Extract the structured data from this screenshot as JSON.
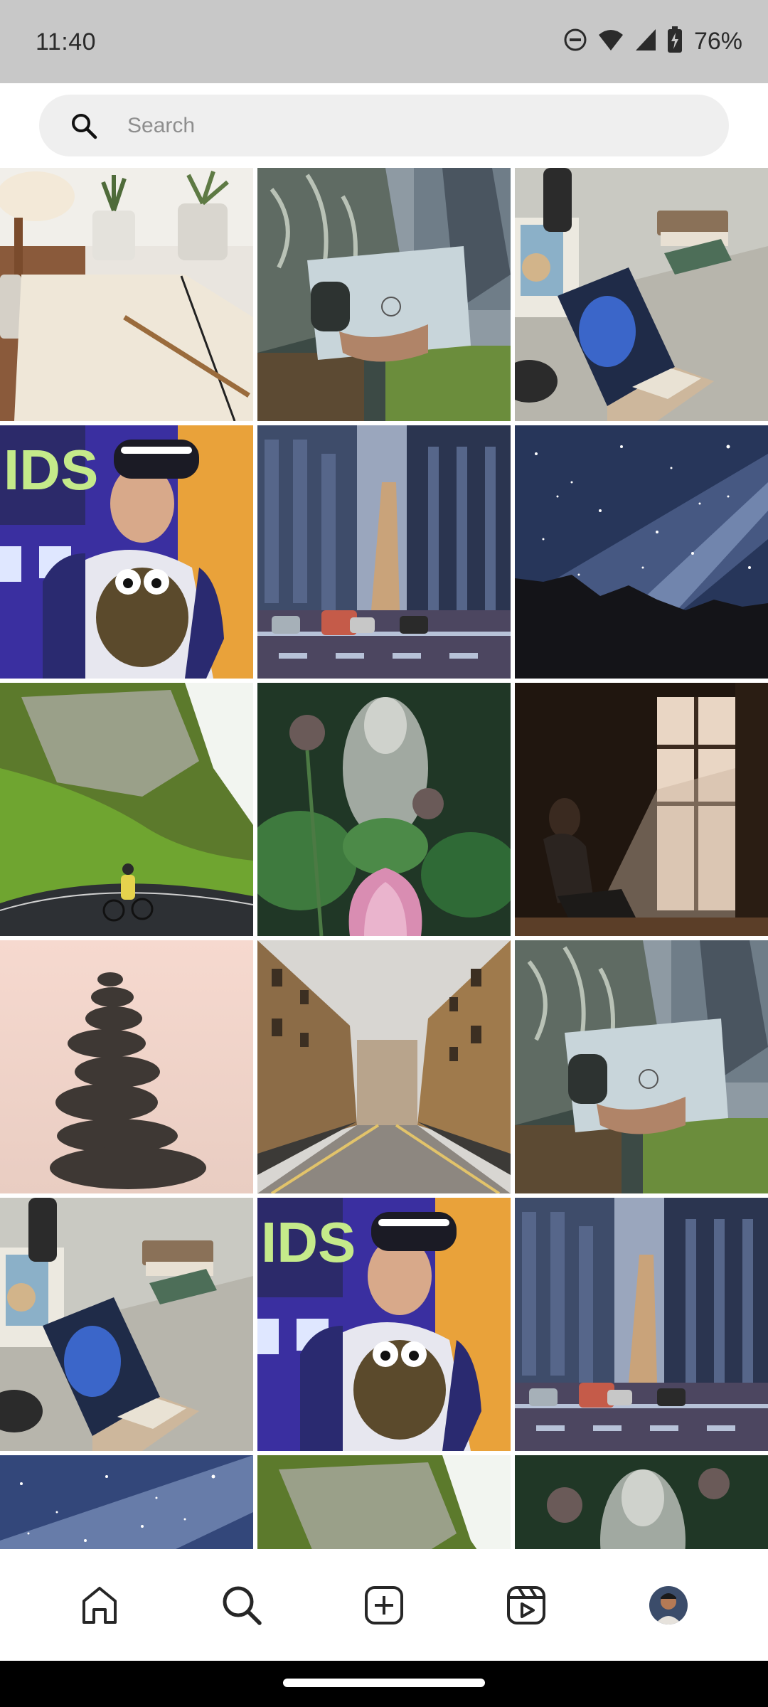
{
  "status_bar": {
    "time": "11:40",
    "battery_percent": "76%",
    "icons": [
      "do-not-disturb-icon",
      "wifi-icon",
      "cellular-signal-icon",
      "battery-charging-icon"
    ]
  },
  "search": {
    "placeholder": "Search",
    "icon": "search-icon"
  },
  "grid": {
    "columns": 3,
    "tiles": [
      {
        "subject": "notebook-and-pencil-on-desk-with-plants"
      },
      {
        "subject": "person-holding-dell-laptop"
      },
      {
        "subject": "laptop-on-desk-with-lamp"
      },
      {
        "subject": "person-wearing-vr-headset"
      },
      {
        "subject": "city-street-with-skyscrapers"
      },
      {
        "subject": "milky-way-night-sky-over-mountains"
      },
      {
        "subject": "cyclist-on-road-by-green-cliffs"
      },
      {
        "subject": "buddha-statue-with-lotus-flower"
      },
      {
        "subject": "woman-sitting-by-sunlit-window"
      },
      {
        "subject": "stacked-stones-cairn"
      },
      {
        "subject": "cobblestone-street-between-buildings"
      },
      {
        "subject": "person-holding-dell-laptop"
      },
      {
        "subject": "laptop-on-desk-with-lamp"
      },
      {
        "subject": "person-wearing-vr-headset"
      },
      {
        "subject": "city-street-with-skyscrapers"
      },
      {
        "subject": "milky-way-night-sky"
      },
      {
        "subject": "green-cliffs"
      },
      {
        "subject": "buddha-statue-with-lotus"
      }
    ]
  },
  "bottom_nav": {
    "items": [
      {
        "icon": "home-icon"
      },
      {
        "icon": "search-icon",
        "active": true
      },
      {
        "icon": "create-post-icon"
      },
      {
        "icon": "reels-icon"
      },
      {
        "icon": "profile-avatar"
      }
    ]
  },
  "colors": {
    "status_bar_bg": "#c8c8c8",
    "search_bg": "#efefef",
    "placeholder": "#8e8e8e",
    "icon": "#262626"
  }
}
